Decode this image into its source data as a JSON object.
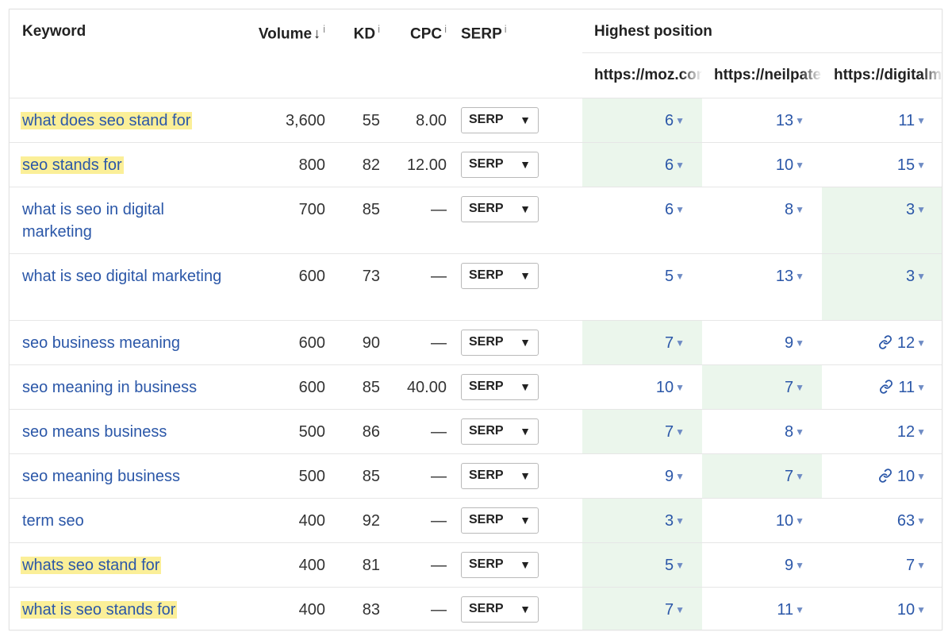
{
  "headers": {
    "keyword": "Keyword",
    "volume": "Volume",
    "volume_sort_icon": "arrow-down",
    "kd": "KD",
    "cpc": "CPC",
    "serp": "SERP",
    "info_glyph": "i",
    "highest_position": "Highest position",
    "urls": [
      "https://moz.com",
      "https://neilpatel.com",
      "https://digitalmarketing"
    ]
  },
  "serp_button_label": "SERP",
  "rows": [
    {
      "keyword": "what does seo stand for",
      "highlighted": true,
      "volume": "3,600",
      "kd": "55",
      "cpc": "8.00",
      "positions": [
        "6",
        "13",
        "11"
      ],
      "best_col": 0,
      "link_icon": false
    },
    {
      "keyword": "seo stands for",
      "highlighted": true,
      "volume": "800",
      "kd": "82",
      "cpc": "12.00",
      "positions": [
        "6",
        "10",
        "15"
      ],
      "best_col": 0,
      "link_icon": false
    },
    {
      "keyword": "what is seo in digital marketing",
      "highlighted": false,
      "volume": "700",
      "kd": "85",
      "cpc": "—",
      "positions": [
        "6",
        "8",
        "3"
      ],
      "best_col": 2,
      "link_icon": false
    },
    {
      "keyword": "what is seo digital marketing",
      "highlighted": false,
      "volume": "600",
      "kd": "73",
      "cpc": "—",
      "positions": [
        "5",
        "13",
        "3"
      ],
      "best_col": 2,
      "link_icon": false
    },
    {
      "keyword": "seo business meaning",
      "highlighted": false,
      "volume": "600",
      "kd": "90",
      "cpc": "—",
      "positions": [
        "7",
        "9",
        "12"
      ],
      "best_col": 0,
      "link_icon": true
    },
    {
      "keyword": "seo meaning in business",
      "highlighted": false,
      "volume": "600",
      "kd": "85",
      "cpc": "40.00",
      "positions": [
        "10",
        "7",
        "11"
      ],
      "best_col": 1,
      "link_icon": true
    },
    {
      "keyword": "seo means business",
      "highlighted": false,
      "volume": "500",
      "kd": "86",
      "cpc": "—",
      "positions": [
        "7",
        "8",
        "12"
      ],
      "best_col": 0,
      "link_icon": false
    },
    {
      "keyword": "seo meaning business",
      "highlighted": false,
      "volume": "500",
      "kd": "85",
      "cpc": "—",
      "positions": [
        "9",
        "7",
        "10"
      ],
      "best_col": 1,
      "link_icon": true
    },
    {
      "keyword": "term seo",
      "highlighted": false,
      "volume": "400",
      "kd": "92",
      "cpc": "—",
      "positions": [
        "3",
        "10",
        "63"
      ],
      "best_col": 0,
      "link_icon": false
    },
    {
      "keyword": "whats seo stand for",
      "highlighted": true,
      "volume": "400",
      "kd": "81",
      "cpc": "—",
      "positions": [
        "5",
        "9",
        "7"
      ],
      "best_col": 0,
      "link_icon": false
    },
    {
      "keyword": "what is seo stands for",
      "highlighted": true,
      "volume": "400",
      "kd": "83",
      "cpc": "—",
      "positions": [
        "7",
        "11",
        "10"
      ],
      "best_col": 0,
      "link_icon": false
    }
  ],
  "colors": {
    "keyword_link": "#2b57a8",
    "highlight": "#fbef98",
    "best_position_bg": "#ebf6ec"
  }
}
